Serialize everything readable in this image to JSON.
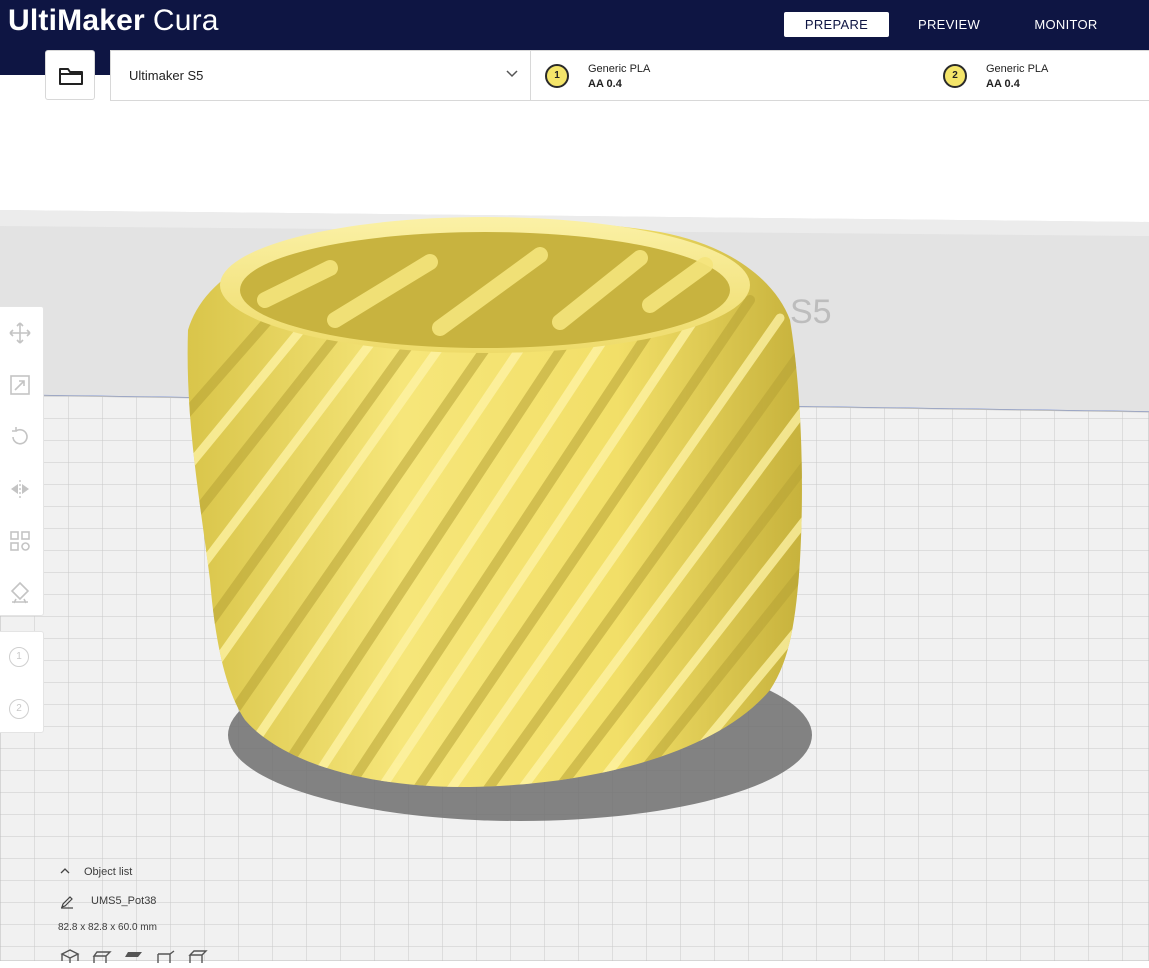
{
  "header": {
    "brand": "UltiMaker",
    "product": "Cura",
    "tabs": [
      {
        "label": "PREPARE",
        "active": true
      },
      {
        "label": "PREVIEW",
        "active": false
      },
      {
        "label": "MONITOR",
        "active": false
      }
    ]
  },
  "toolbar": {
    "open_icon": "folder-icon",
    "machine": "Ultimaker S5",
    "extruders": [
      {
        "number": "1",
        "material": "Generic PLA",
        "nozzle": "AA 0.4"
      },
      {
        "number": "2",
        "material": "Generic PLA",
        "nozzle": "AA 0.4"
      }
    ]
  },
  "viewport": {
    "build_plate_label": "S5",
    "model_color": "#f3e163"
  },
  "tools": [
    "move-icon",
    "scale-icon",
    "rotate-icon",
    "mirror-icon",
    "per-model-settings-icon",
    "support-blocker-icon"
  ],
  "extruder_tools": [
    "1",
    "2"
  ],
  "object_list": {
    "title": "Object list",
    "item": "UMS5_Pot38",
    "dimensions": "82.8 x 82.8 x 60.0 mm"
  },
  "colors": {
    "header_bg": "#0e1543",
    "accent": "#0e1543"
  }
}
